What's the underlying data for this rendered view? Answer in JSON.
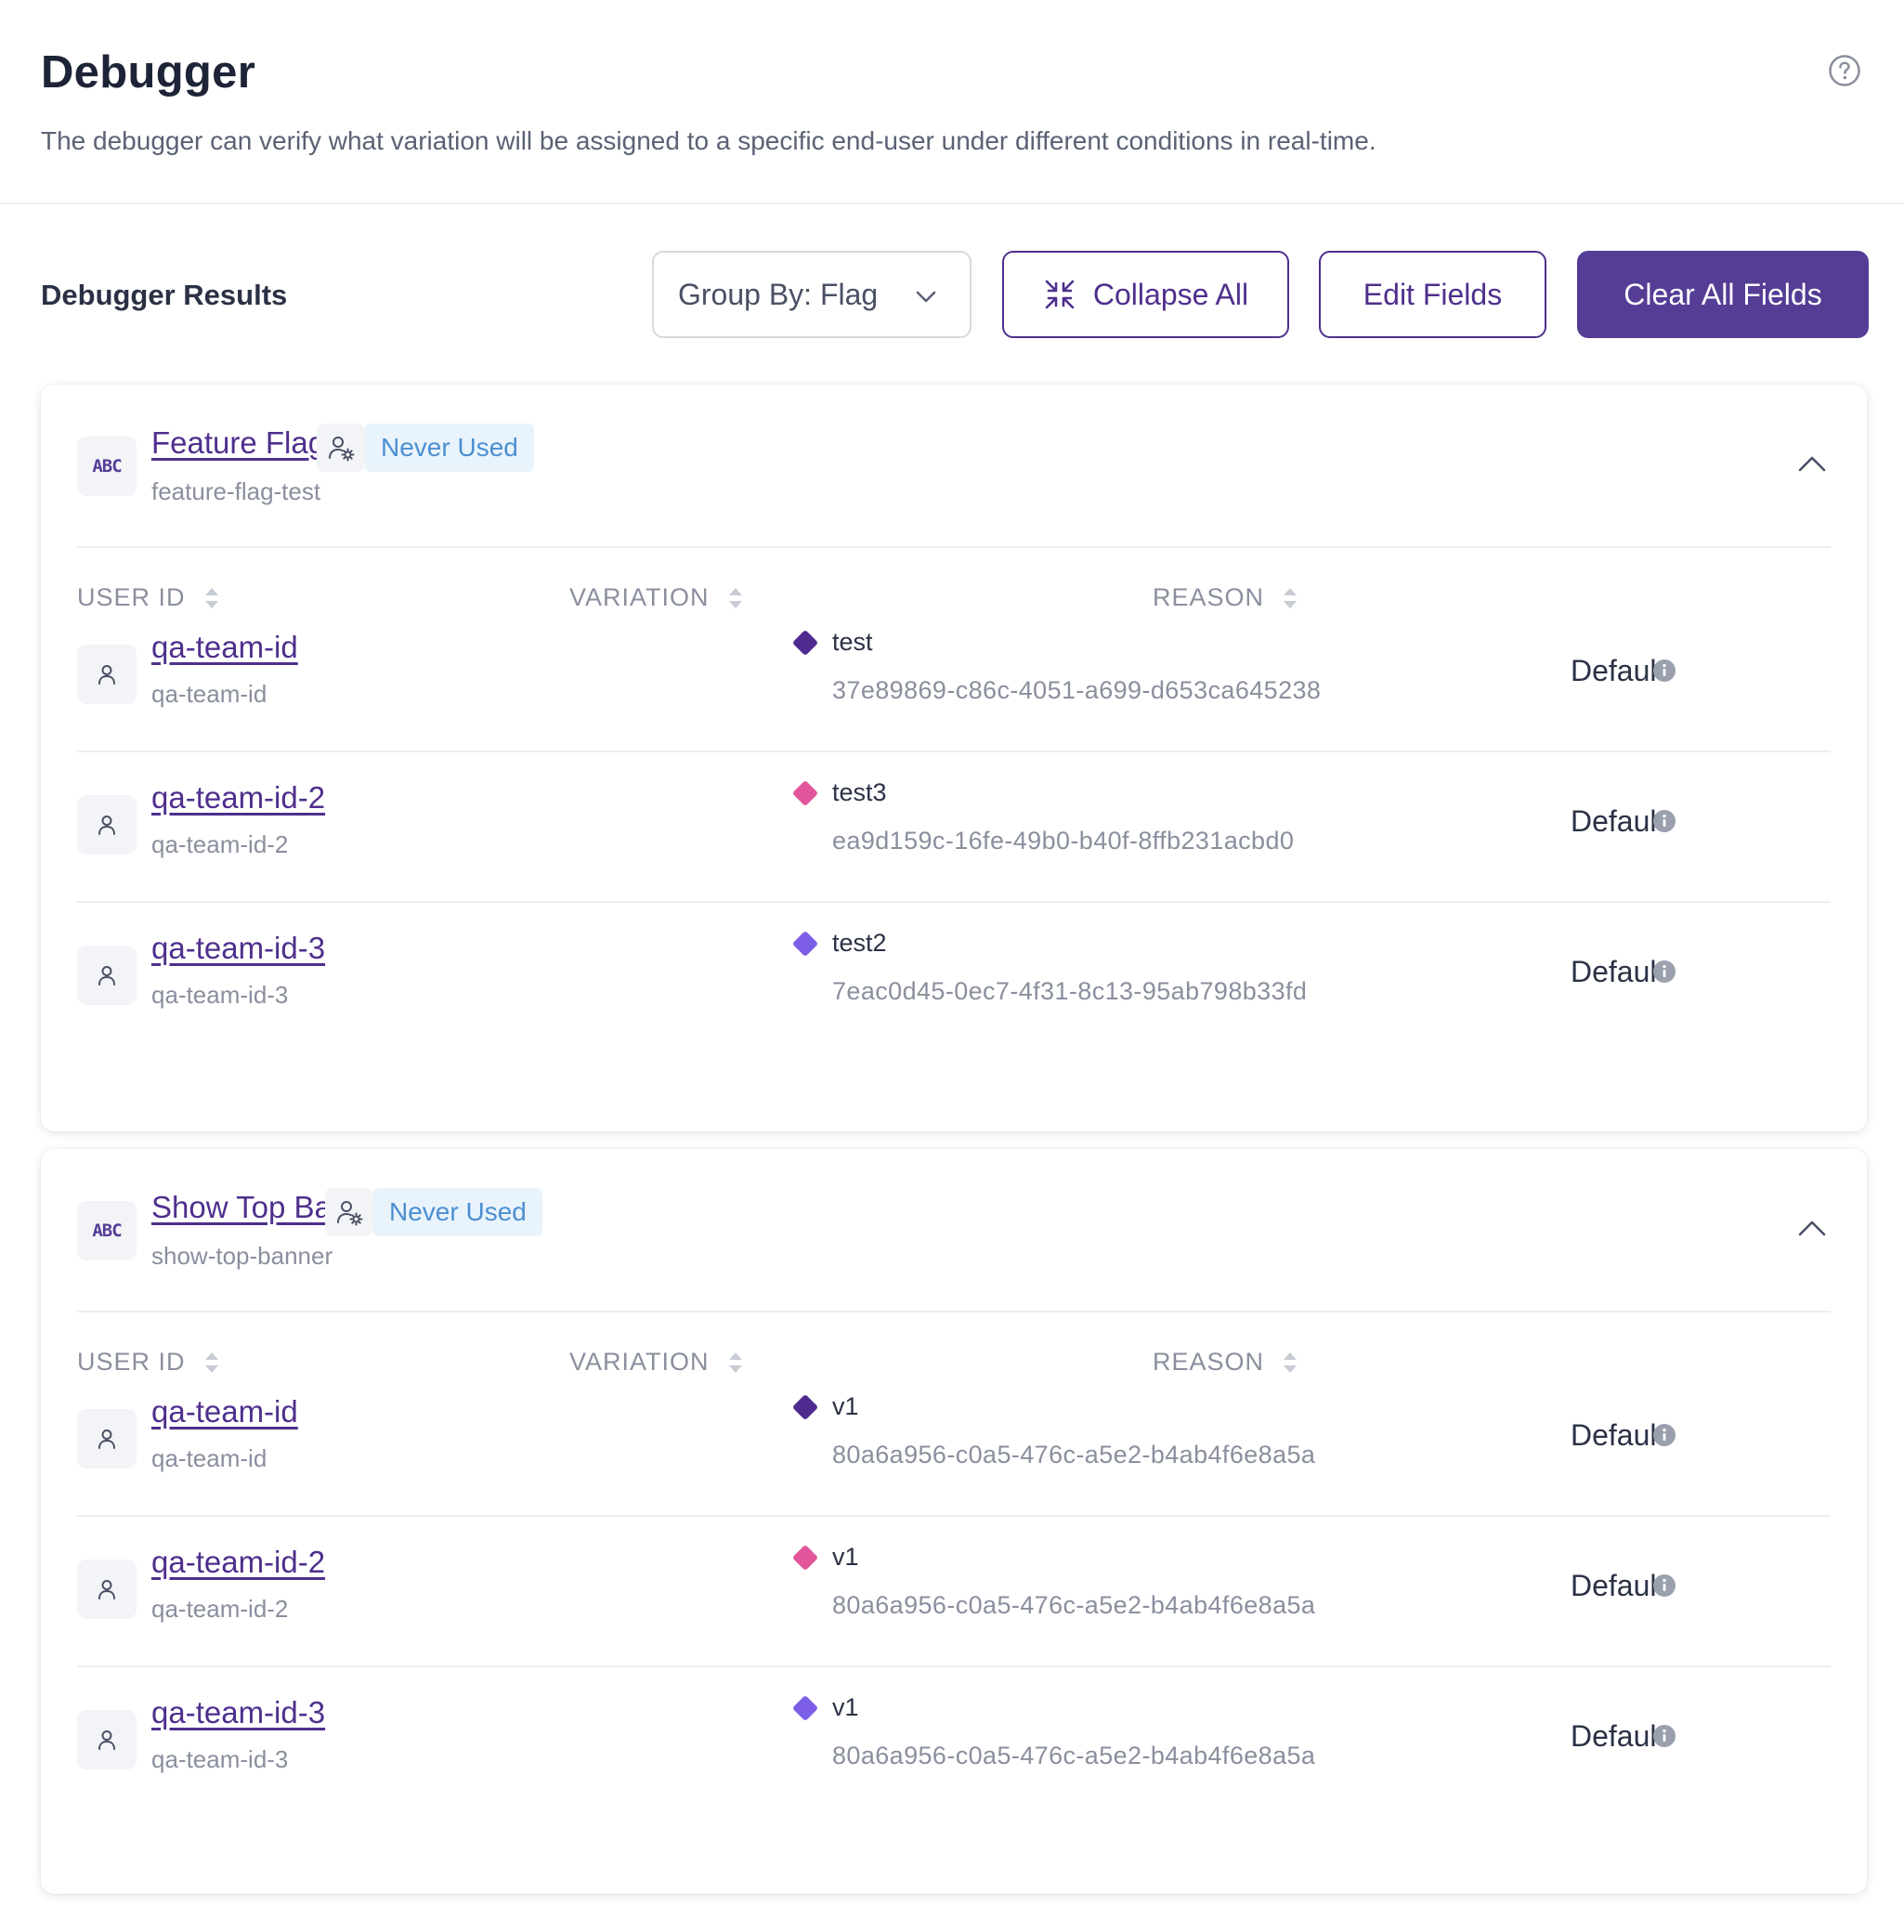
{
  "header": {
    "title": "Debugger",
    "description": "The debugger can verify what variation will be assigned to a specific end-user under different conditions in real-time."
  },
  "toolbar": {
    "results_title": "Debugger Results",
    "group_by_label": "Group By: Flag",
    "collapse_label": "Collapse All",
    "edit_label": "Edit Fields",
    "clear_label": "Clear All Fields"
  },
  "columns": {
    "user_id": "USER ID",
    "variation": "VARIATION",
    "reason": "REASON"
  },
  "colors": {
    "brand": "#553c95",
    "variation_1": "#4f2a8f",
    "variation_2": "#e3559a",
    "variation_3": "#7c5ee6",
    "badge_bg": "#e9f3fc",
    "badge_text": "#4b8fd1"
  },
  "flags": [
    {
      "badge": "ABC",
      "name": "Feature Flag Test",
      "key": "feature-flag-test",
      "status": "Never Used",
      "rows": [
        {
          "user": "qa-team-id",
          "user_key": "qa-team-id",
          "variation": "test",
          "variation_id": "37e89869-c86c-4051-a699-d653ca645238",
          "reason": "Default"
        },
        {
          "user": "qa-team-id-2",
          "user_key": "qa-team-id-2",
          "variation": "test3",
          "variation_id": "ea9d159c-16fe-49b0-b40f-8ffb231acbd0",
          "reason": "Default"
        },
        {
          "user": "qa-team-id-3",
          "user_key": "qa-team-id-3",
          "variation": "test2",
          "variation_id": "7eac0d45-0ec7-4f31-8c13-95ab798b33fd",
          "reason": "Default"
        }
      ]
    },
    {
      "badge": "ABC",
      "name": "Show Top Banner",
      "key": "show-top-banner",
      "status": "Never Used",
      "rows": [
        {
          "user": "qa-team-id",
          "user_key": "qa-team-id",
          "variation": "v1",
          "variation_id": "80a6a956-c0a5-476c-a5e2-b4ab4f6e8a5a",
          "reason": "Default"
        },
        {
          "user": "qa-team-id-2",
          "user_key": "qa-team-id-2",
          "variation": "v1",
          "variation_id": "80a6a956-c0a5-476c-a5e2-b4ab4f6e8a5a",
          "reason": "Default"
        },
        {
          "user": "qa-team-id-3",
          "user_key": "qa-team-id-3",
          "variation": "v1",
          "variation_id": "80a6a956-c0a5-476c-a5e2-b4ab4f6e8a5a",
          "reason": "Default"
        }
      ]
    }
  ]
}
